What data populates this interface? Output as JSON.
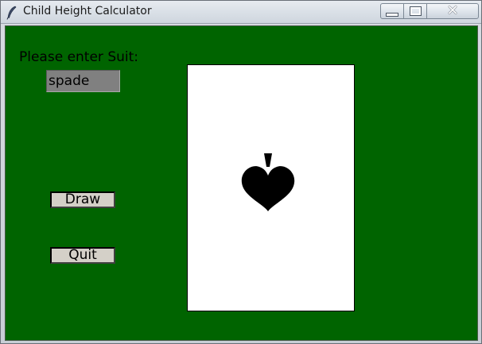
{
  "window": {
    "title": "Child Height Calculator",
    "icon": "feather-icon",
    "controls": {
      "minimize": "minimize-icon",
      "maximize": "maximize-icon",
      "close": "✕"
    }
  },
  "form": {
    "prompt_label": "Please enter Suit:",
    "suit_value": "spade",
    "draw_label": "Draw",
    "quit_label": "Quit"
  },
  "card": {
    "suit": "spade",
    "suit_icon": "spade-icon"
  },
  "colors": {
    "background": "#006400",
    "card": "#ffffff",
    "input_bg": "#808080",
    "button_bg": "#d4d0c8"
  }
}
